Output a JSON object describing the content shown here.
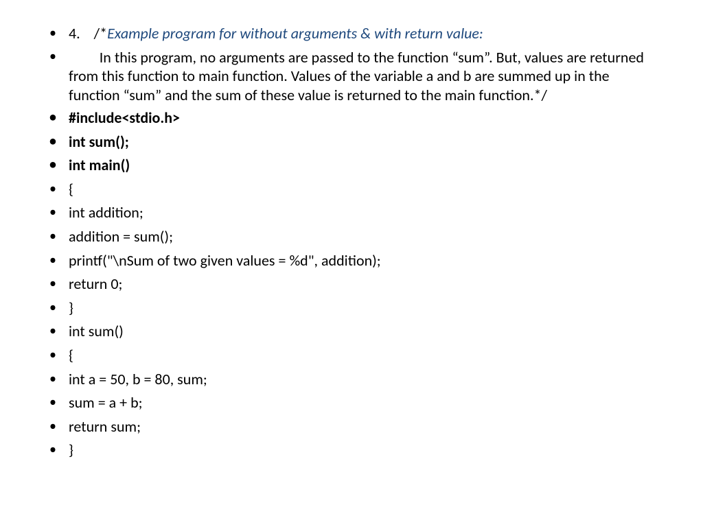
{
  "bullets": {
    "b1_prefix": "4.    /*",
    "b1_blue": "Example program for without arguments & with return value:",
    "b2_lead": "         ",
    "b2_text": "In this program, no arguments are passed to the function “sum”. But, values are returned from this function to main function. Values of the variable a and b are summed up in the function “sum” and the sum of these value is returned to the main function.*/",
    "b3": "#include<stdio.h>",
    "b4": "int sum();",
    "b5": "int main()",
    "b6": "{",
    "b7": "int addition;",
    "b8": "addition = sum();",
    "b9": "printf(\"\\nSum of two given values = %d\", addition);",
    "b10": "return 0;",
    "b11": "}",
    "b12": "int sum()",
    "b13": "{",
    "b14": "int a = 50, b = 80, sum;",
    "b15": "sum = a + b;",
    "b16": "return sum;",
    "b17": "}"
  }
}
